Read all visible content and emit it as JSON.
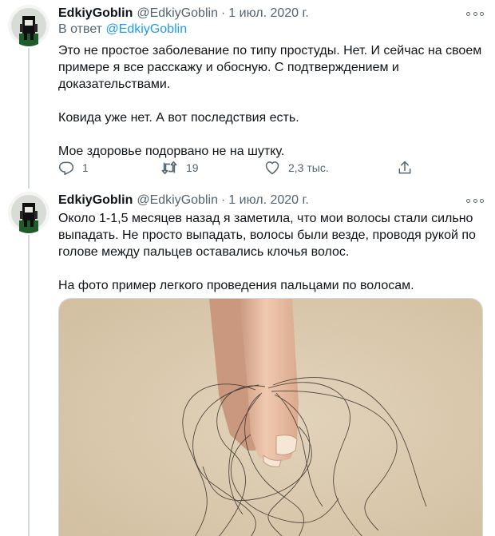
{
  "tweets": [
    {
      "author_name": "EdkiyGoblin",
      "handle": "@EdkiyGoblin",
      "separator": "·",
      "date": "1 июл. 2020 г.",
      "reply_prefix": "В ответ",
      "reply_handle": "@EdkiyGoblin",
      "paragraphs": [
        "Это не простое заболевание по типу простуды. Нет. И сейчас на своем примере я все расскажу и обосную. С подтверждением и доказательствами.",
        "Ковида уже нет. А вот последствия есть.",
        "Мое здоровье подорвано не на шутку."
      ],
      "reply_count": "1",
      "retweet_count": "19",
      "like_count": "2,3 тыс."
    },
    {
      "author_name": "EdkiyGoblin",
      "handle": "@EdkiyGoblin",
      "separator": "·",
      "date": "1 июл. 2020 г.",
      "paragraphs": [
        "Около 1-1,5 месяцев назад я заметила, что мои волосы стали сильно выпадать. Не просто выпадать, волосы были везде, проводя рукой по голове между пальцев оставались клочья волос.",
        "На фото пример легкого проведения пальцами по волосам."
      ]
    }
  ],
  "icons": {
    "reply": "reply-icon",
    "retweet": "retweet-icon",
    "like": "heart-icon",
    "share": "share-icon",
    "more": "more-icon"
  },
  "colors": {
    "link": "#1d9bf0",
    "secondary_text": "#536471",
    "thread_line": "#cfd9de",
    "wall": "#e2d2b8"
  }
}
